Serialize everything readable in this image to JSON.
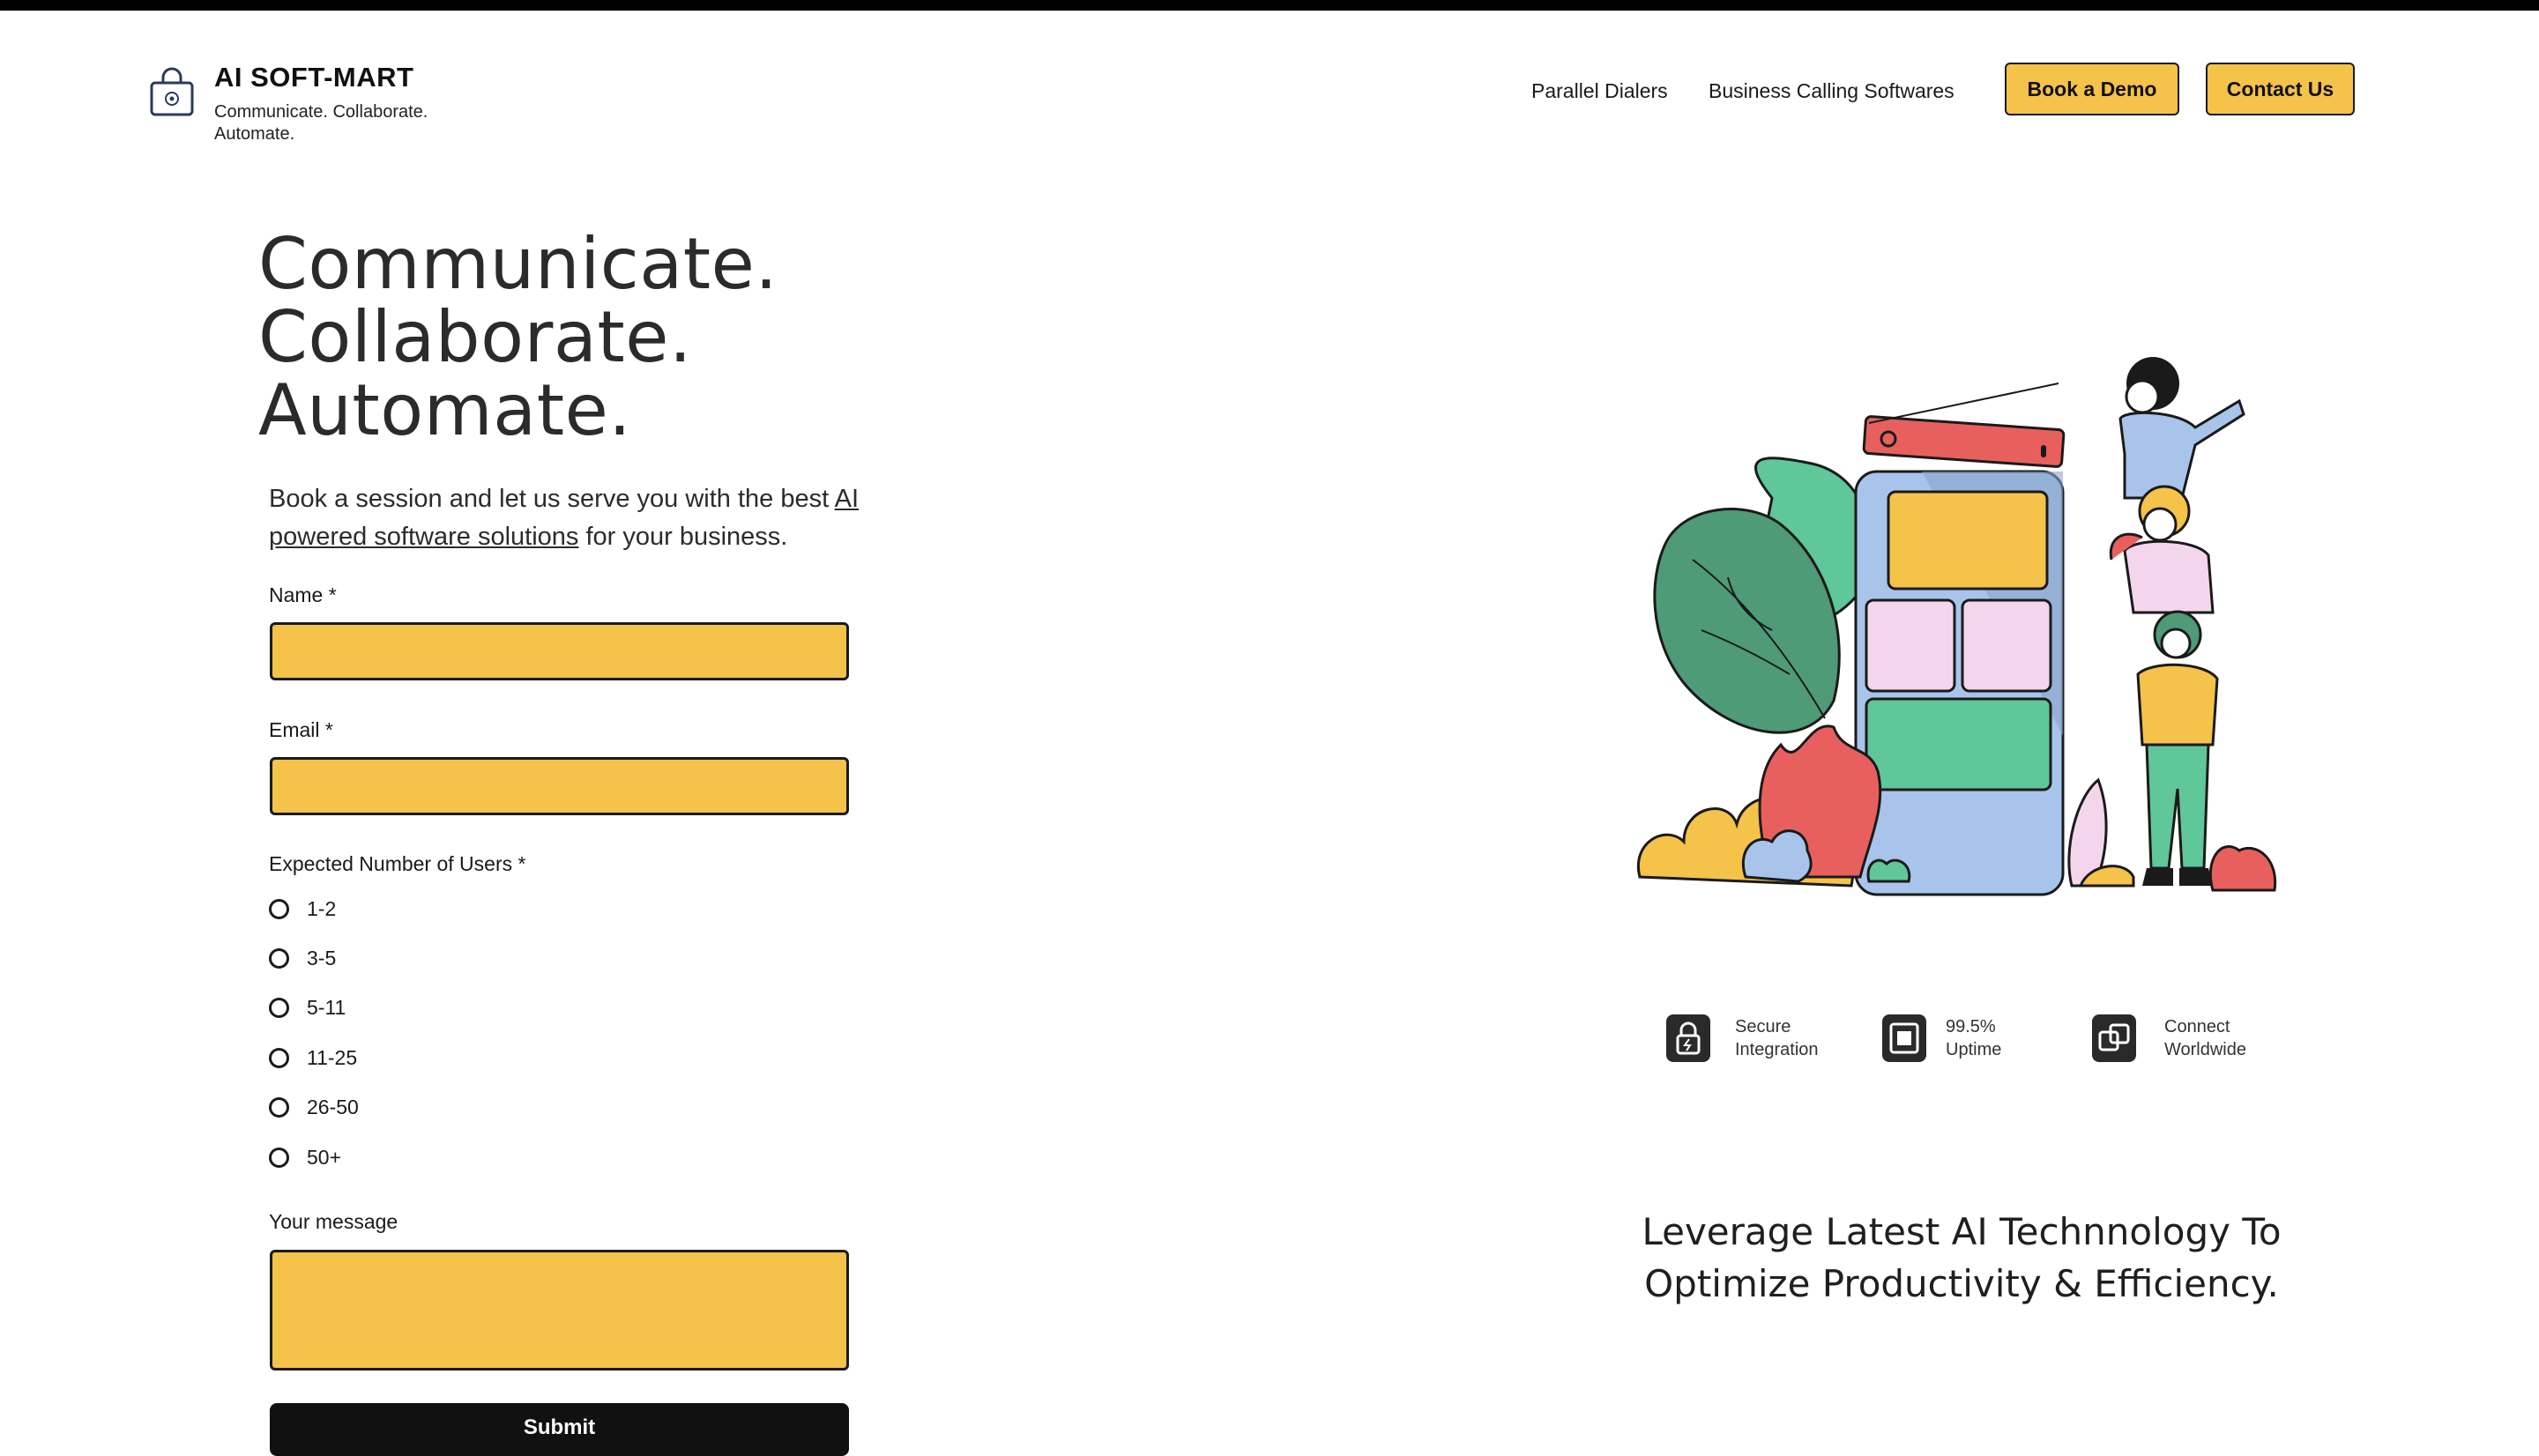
{
  "header": {
    "brand_name": "AI SOFT-MART",
    "brand_tagline": "Communicate. Collaborate. Automate.",
    "nav": {
      "link_parallel": "Parallel Dialers",
      "link_business": "Business Calling Softwares",
      "book_demo": "Book a Demo",
      "contact_us": "Contact Us"
    }
  },
  "hero": {
    "title_lines": [
      "Communicate.",
      "Collaborate.",
      "Automate."
    ],
    "intro_before": "Book a session and let us serve you with the best ",
    "intro_link": "AI powered software solutions",
    "intro_after": " for your business."
  },
  "form": {
    "name_label": "Name *",
    "name_value": "",
    "email_label": "Email *",
    "email_value": "",
    "users_label": "Expected Number of Users *",
    "user_options": [
      "1-2",
      "3-5",
      "5-11",
      "11-25",
      "26-50",
      "50+"
    ],
    "message_label": "Your message",
    "message_value": "",
    "submit_label": "Submit"
  },
  "features": [
    {
      "label": "Secure Integration",
      "icon": "lock-icon"
    },
    {
      "label": "99.5% Uptime",
      "icon": "uptime-square-icon"
    },
    {
      "label": "Connect Worldwide",
      "icon": "link-squares-icon"
    }
  ],
  "tagline": "Leverage Latest AI Technnology To Optimize Productivity & Efficiency.",
  "colors": {
    "accent": "#f5c24a",
    "dark": "#111111",
    "green": "#4f9a77",
    "red": "#e8605e",
    "pink": "#f4d6ec",
    "blue": "#a8c4ea"
  }
}
